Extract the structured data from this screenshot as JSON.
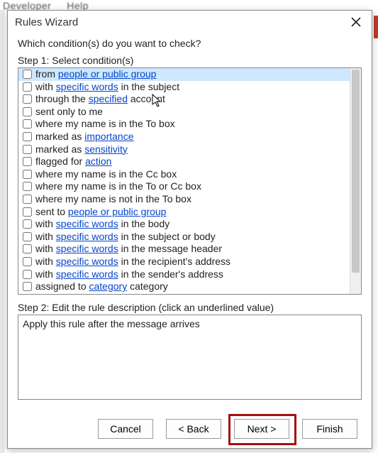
{
  "bg_ribbon": {
    "dev": "Developer",
    "help": "Help"
  },
  "dialog": {
    "title": "Rules Wizard",
    "prompt": "Which condition(s) do you want to check?",
    "step1_label": "Step 1: Select condition(s)",
    "conditions": [
      {
        "selected": true,
        "parts": [
          {
            "t": "from "
          },
          {
            "t": "people or public group",
            "link": true
          }
        ]
      },
      {
        "selected": false,
        "parts": [
          {
            "t": "with "
          },
          {
            "t": "specific words",
            "link": true
          },
          {
            "t": " in the subject"
          }
        ]
      },
      {
        "selected": false,
        "parts": [
          {
            "t": "through the "
          },
          {
            "t": "specified",
            "link": true
          },
          {
            "t": " account"
          }
        ]
      },
      {
        "selected": false,
        "parts": [
          {
            "t": "sent only to me"
          }
        ]
      },
      {
        "selected": false,
        "parts": [
          {
            "t": "where my name is in the To box"
          }
        ]
      },
      {
        "selected": false,
        "parts": [
          {
            "t": "marked as "
          },
          {
            "t": "importance",
            "link": true
          }
        ]
      },
      {
        "selected": false,
        "parts": [
          {
            "t": "marked as "
          },
          {
            "t": "sensitivity",
            "link": true
          }
        ]
      },
      {
        "selected": false,
        "parts": [
          {
            "t": "flagged for "
          },
          {
            "t": "action",
            "link": true
          }
        ]
      },
      {
        "selected": false,
        "parts": [
          {
            "t": "where my name is in the Cc box"
          }
        ]
      },
      {
        "selected": false,
        "parts": [
          {
            "t": "where my name is in the To or Cc box"
          }
        ]
      },
      {
        "selected": false,
        "parts": [
          {
            "t": "where my name is not in the To box"
          }
        ]
      },
      {
        "selected": false,
        "parts": [
          {
            "t": "sent to "
          },
          {
            "t": "people or public group",
            "link": true
          }
        ]
      },
      {
        "selected": false,
        "parts": [
          {
            "t": "with "
          },
          {
            "t": "specific words",
            "link": true
          },
          {
            "t": " in the body"
          }
        ]
      },
      {
        "selected": false,
        "parts": [
          {
            "t": "with "
          },
          {
            "t": "specific words",
            "link": true
          },
          {
            "t": " in the subject or body"
          }
        ]
      },
      {
        "selected": false,
        "parts": [
          {
            "t": "with "
          },
          {
            "t": "specific words",
            "link": true
          },
          {
            "t": " in the message header"
          }
        ]
      },
      {
        "selected": false,
        "parts": [
          {
            "t": "with "
          },
          {
            "t": "specific words",
            "link": true
          },
          {
            "t": " in the recipient's address"
          }
        ]
      },
      {
        "selected": false,
        "parts": [
          {
            "t": "with "
          },
          {
            "t": "specific words",
            "link": true
          },
          {
            "t": " in the sender's address"
          }
        ]
      },
      {
        "selected": false,
        "parts": [
          {
            "t": "assigned to "
          },
          {
            "t": "category",
            "link": true
          },
          {
            "t": " category"
          }
        ]
      }
    ],
    "step2_label": "Step 2: Edit the rule description (click an underlined value)",
    "description_text": "Apply this rule after the message arrives",
    "buttons": {
      "cancel": "Cancel",
      "back": "< Back",
      "next": "Next >",
      "finish": "Finish"
    }
  }
}
